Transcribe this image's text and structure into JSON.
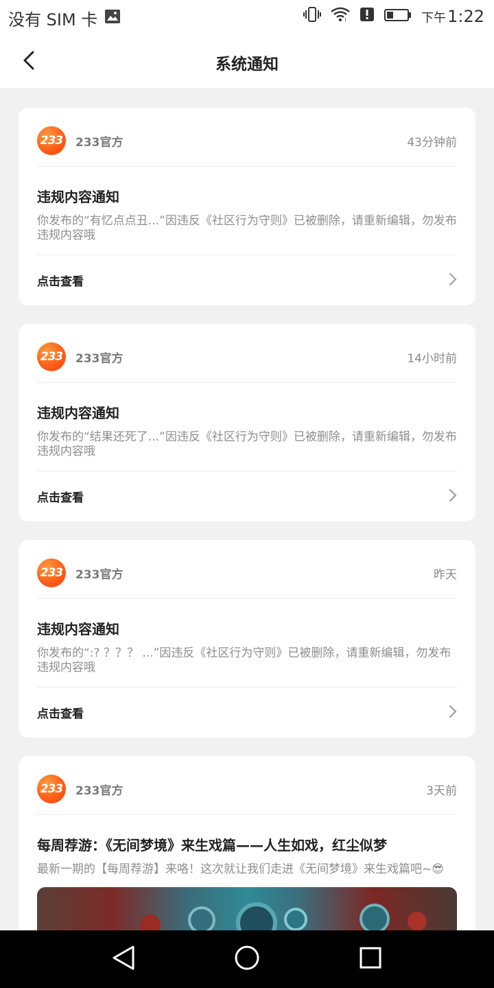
{
  "status_bar": {
    "carrier": "没有 SIM 卡",
    "time_prefix": "下午",
    "time": "1:22"
  },
  "header": {
    "title": "系统通知"
  },
  "cards": [
    {
      "avatar": "233",
      "sender": "233官方",
      "time": "43分钟前",
      "title": "违规内容通知",
      "body": "你发布的“有忆点点丑...”因违反《社区行为守则》已被删除，请重新编辑，勿发布违规内容哦",
      "action": "点击查看"
    },
    {
      "avatar": "233",
      "sender": "233官方",
      "time": "14小时前",
      "title": "违规内容通知",
      "body": "你发布的“结果还死了...”因违反《社区行为守则》已被删除，请重新编辑，勿发布违规内容哦",
      "action": "点击查看"
    },
    {
      "avatar": "233",
      "sender": "233官方",
      "time": "昨天",
      "title": "违规内容通知",
      "body": "你发布的“:? ？？？ ...”因违反《社区行为守则》已被删除，请重新编辑，勿发布违规内容哦",
      "action": "点击查看"
    },
    {
      "avatar": "233",
      "sender": "233官方",
      "time": "3天前",
      "title": "每周荐游：《无间梦境》来生戏篇——人生如戏，红尘似梦",
      "body": "最新一期的【每周荐游】来咯！这次就让我们走进《无间梦境》来生戏篇吧~😎"
    }
  ],
  "colors": {
    "accent": "#ff5a17",
    "background": "#f1f1f1"
  },
  "icons": {
    "back": "chevron-left-icon",
    "chevron": "chevron-right-icon",
    "nav": [
      "back-triangle-icon",
      "home-circle-icon",
      "recents-square-icon"
    ]
  }
}
